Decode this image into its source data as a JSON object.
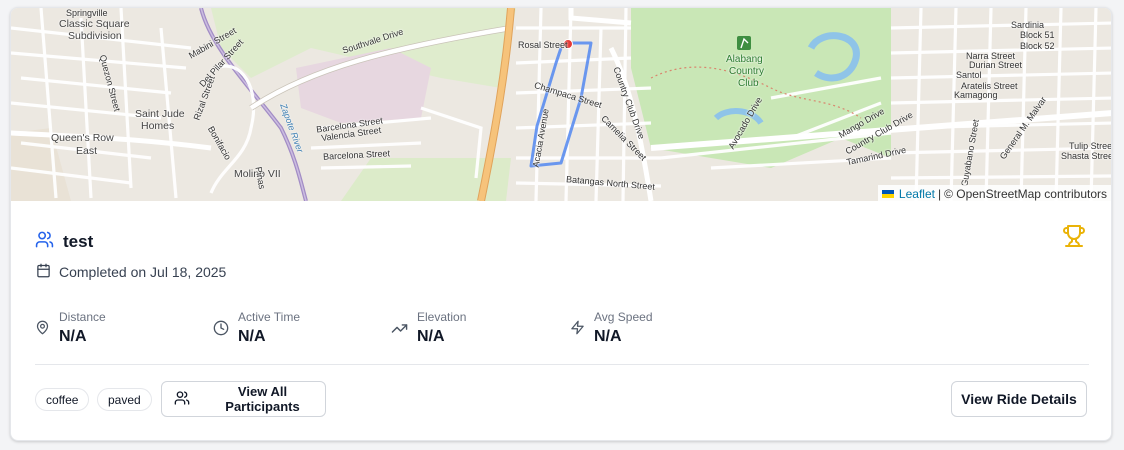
{
  "map": {
    "attribution": {
      "leaflet": "Leaflet",
      "separator": "|",
      "copyright": "© OpenStreetMap contributors"
    },
    "labels": [
      "Springville",
      "Classic Square",
      "Subdivision",
      "Southvale Drive",
      "Mabini Street",
      "Del Pilar Street",
      "Quezon Street",
      "Saint Jude",
      "Homes",
      "Rizal Street",
      "Bonifacio",
      "Queen's Row",
      "East",
      "Molino VII",
      "Barcelona Street",
      "Valencia Street",
      "Rosal Street",
      "Champaca Street",
      "Country Club Drive",
      "Acacia Avenue",
      "Camelia Street",
      "Batangas North Street",
      "Alabang",
      "Country",
      "Club",
      "Avocado Drive",
      "Mango Drive",
      "Tamarind Drive",
      "Block 51",
      "Block 52",
      "Narra Street",
      "Durian Street",
      "Santol",
      "Aratelis Street",
      "Kamagong",
      "Tulip Street",
      "Shasta Street",
      "Sardinia",
      "Guyabano Street",
      "General M. Malvar",
      "Avenue",
      "Zapote River",
      "Pinas"
    ]
  },
  "ride": {
    "title": "test",
    "completed": "Completed on Jul 18, 2025"
  },
  "stats": [
    {
      "label": "Distance",
      "value": "N/A",
      "icon": "map-pin-icon"
    },
    {
      "label": "Active Time",
      "value": "N/A",
      "icon": "clock-icon"
    },
    {
      "label": "Elevation",
      "value": "N/A",
      "icon": "trending-up-icon"
    },
    {
      "label": "Avg Speed",
      "value": "N/A",
      "icon": "zap-icon"
    }
  ],
  "tags": [
    "coffee",
    "paved"
  ],
  "buttons": {
    "participants": "View All Participants",
    "details": "View Ride Details"
  },
  "colors": {
    "accent": "#2563eb",
    "trophy": "#eab308",
    "route": "#5b8def",
    "start_marker": "#e53935"
  }
}
